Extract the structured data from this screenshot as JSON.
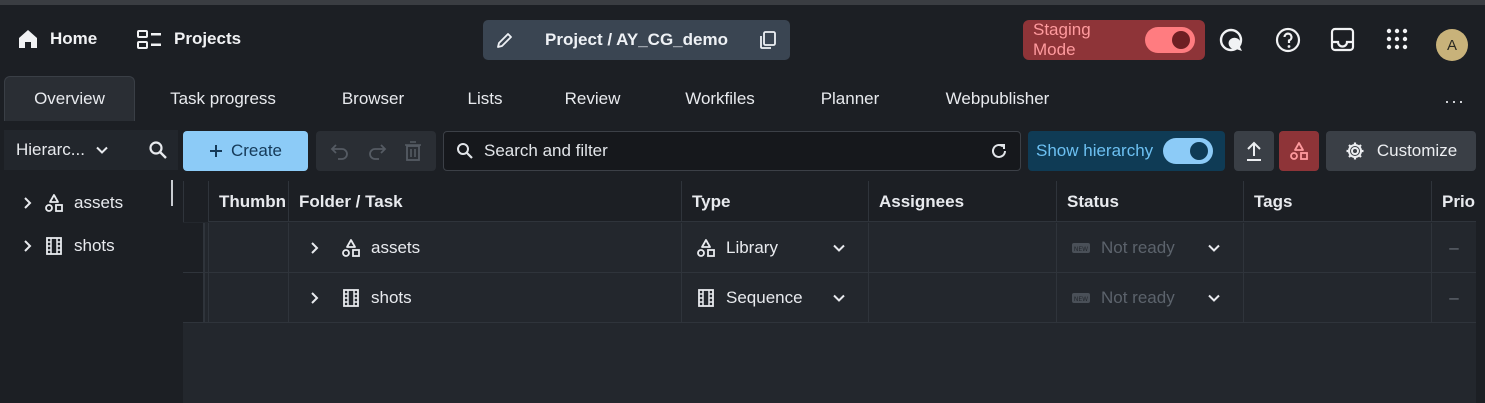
{
  "topbar": {
    "home_label": "Home",
    "projects_label": "Projects",
    "project_label": "Project / AY_CG_demo",
    "staging_label": "Staging Mode",
    "avatar_initial": "A"
  },
  "tabs": [
    {
      "label": "Overview",
      "active": true
    },
    {
      "label": "Task progress"
    },
    {
      "label": "Browser"
    },
    {
      "label": "Lists"
    },
    {
      "label": "Review"
    },
    {
      "label": "Workfiles"
    },
    {
      "label": "Planner"
    },
    {
      "label": "Webpublisher"
    }
  ],
  "tabs_more": "···",
  "sidebar": {
    "view_select": "Hierarc...",
    "items": [
      {
        "label": "assets",
        "icon": "shapes-icon"
      },
      {
        "label": "shots",
        "icon": "film-icon"
      }
    ]
  },
  "toolbar": {
    "create_label": "Create",
    "search_placeholder": "Search and filter",
    "show_hierarchy_label": "Show hierarchy",
    "customize_label": "Customize"
  },
  "table": {
    "columns": [
      "Thumbn",
      "Folder / Task",
      "Type",
      "Assignees",
      "Status",
      "Tags",
      "Prio"
    ],
    "rows": [
      {
        "folder": "assets",
        "folder_icon": "shapes-icon",
        "type": "Library",
        "type_icon": "shapes-icon",
        "assignees": "",
        "status": "Not ready",
        "tags": "",
        "priority": "–"
      },
      {
        "folder": "shots",
        "folder_icon": "film-icon",
        "type": "Sequence",
        "type_icon": "film-icon",
        "assignees": "",
        "status": "Not ready",
        "tags": "",
        "priority": "–"
      }
    ]
  },
  "colors": {
    "background": "#1c1f24",
    "accent": "#8ccbf7",
    "staging": "#8e3438",
    "staging_text": "#ff9a9e",
    "hierarchy_bg": "#0f3b55"
  }
}
